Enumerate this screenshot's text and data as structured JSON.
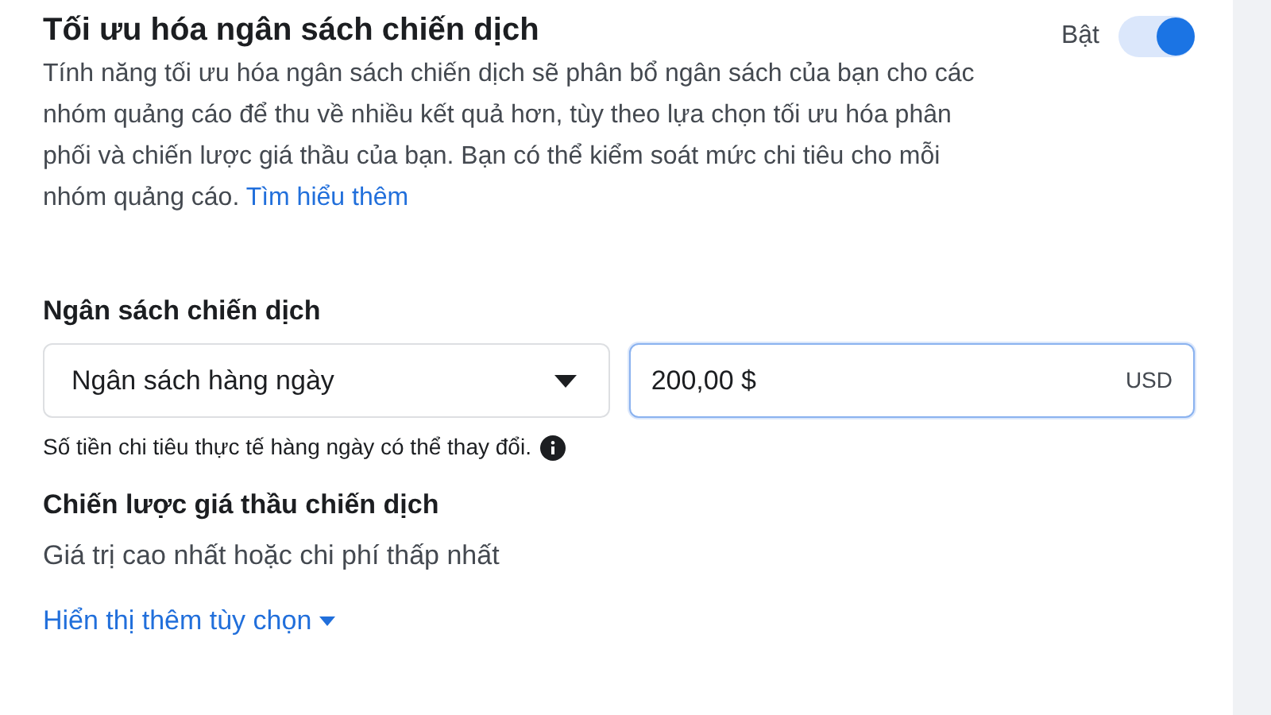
{
  "campaign_budget_optimization": {
    "title": "Tối ưu hóa ngân sách chiến dịch",
    "toggle_label": "Bật",
    "on": true,
    "description": "Tính năng tối ưu hóa ngân sách chiến dịch sẽ phân bổ ngân sách của bạn cho các nhóm quảng cáo để thu về nhiều kết quả hơn, tùy theo lựa chọn tối ưu hóa phân phối và chiến lược giá thầu của bạn. Bạn có thể kiểm soát mức chi tiêu cho mỗi nhóm quảng cáo.",
    "learn_more": "Tìm hiểu thêm"
  },
  "budget": {
    "label": "Ngân sách chiến dịch",
    "type_select": "Ngân sách hàng ngày",
    "amount": "200,00 $",
    "currency": "USD",
    "hint": "Số tiền chi tiêu thực tế hàng ngày có thể thay đổi."
  },
  "bid_strategy": {
    "label": "Chiến lược giá thầu chiến dịch",
    "value": "Giá trị cao nhất hoặc chi phí thấp nhất"
  },
  "more_options": "Hiển thị thêm tùy chọn"
}
